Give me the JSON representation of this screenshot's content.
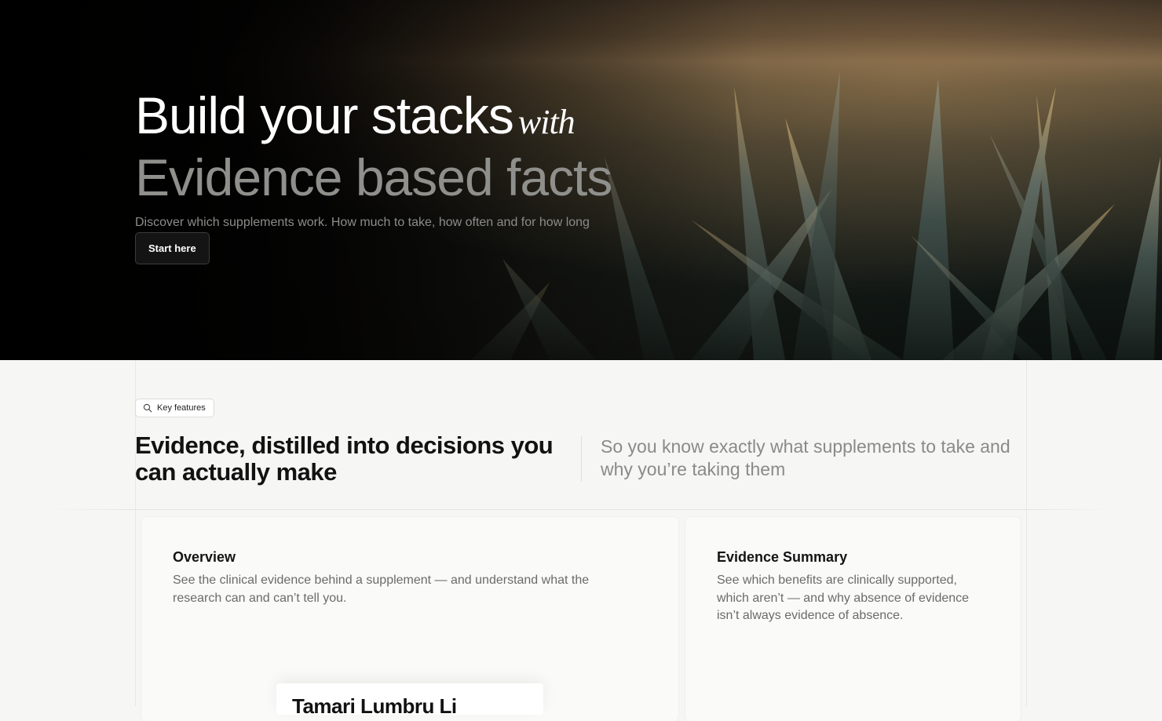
{
  "hero": {
    "title_line1": "Build your stacks",
    "title_with": "with",
    "title_line2": "Evidence based facts",
    "subtitle": "Discover which supplements work. How much to take, how often and for how long",
    "cta_label": "Start here"
  },
  "features": {
    "badge_label": "Key features",
    "badge_icon": "search-icon",
    "title": "Evidence, distilled into decisions you can actually make",
    "subtitle": "So you know exactly what supplements to take and why you’re taking them",
    "cards": [
      {
        "title": "Overview",
        "description": "See the clinical evidence behind a supplement — and understand what the research can and can’t tell you."
      },
      {
        "title": "Evidence Summary",
        "description": "See which benefits are clinically supported, which aren’t — and why absence of evidence isn’t always evidence of absence."
      }
    ],
    "preview_heading": "Tamari Lumbru Li"
  },
  "colors": {
    "hero_title": "#ffffff",
    "hero_title_muted": "#8f8f8c",
    "page_bg": "#f6f6f5",
    "button_bg": "#141414"
  }
}
